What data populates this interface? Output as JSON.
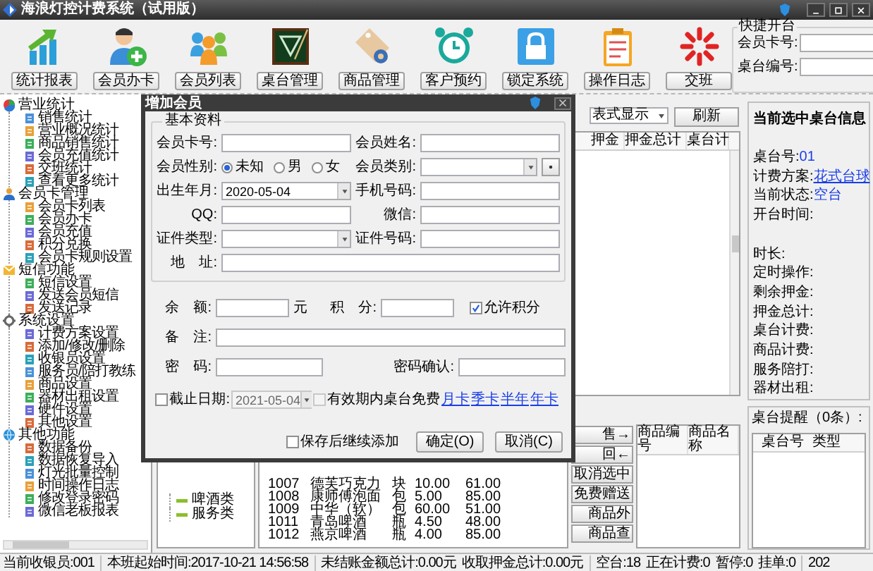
{
  "window": {
    "title": "海浪灯控计费系统（试用版）"
  },
  "toolbar": [
    {
      "label": "统计报表"
    },
    {
      "label": "会员办卡"
    },
    {
      "label": "会员列表"
    },
    {
      "label": "桌台管理"
    },
    {
      "label": "商品管理"
    },
    {
      "label": "客户预约"
    },
    {
      "label": "锁定系统"
    },
    {
      "label": "操作日志"
    },
    {
      "label": "交班"
    }
  ],
  "quick_open": {
    "title": "快捷开台",
    "fields": [
      {
        "label": "会员卡号:"
      },
      {
        "label": "桌台编号:"
      }
    ]
  },
  "tree": [
    {
      "label": "营业统计",
      "children": [
        {
          "label": "销售统计"
        },
        {
          "label": "营业概况统计"
        },
        {
          "label": "商品销售统计"
        },
        {
          "label": "会员充值统计"
        },
        {
          "label": "交班统计"
        },
        {
          "label": "查看更多统计"
        }
      ]
    },
    {
      "label": "会员卡管理",
      "children": [
        {
          "label": "会员卡列表"
        },
        {
          "label": "会员办卡"
        },
        {
          "label": "会员充值"
        },
        {
          "label": "积分兑换"
        },
        {
          "label": "会员卡规则设置"
        }
      ]
    },
    {
      "label": "短信功能",
      "children": [
        {
          "label": "短信设置"
        },
        {
          "label": "发送会员短信"
        },
        {
          "label": "发送记录"
        }
      ]
    },
    {
      "label": "系统设置",
      "children": [
        {
          "label": "计费方案设置"
        },
        {
          "label": "添加/修改/删除"
        },
        {
          "label": "收银员设置"
        },
        {
          "label": "服务员/陪打教练"
        },
        {
          "label": "商品设置"
        },
        {
          "label": "器材出租设置"
        },
        {
          "label": "硬件设置"
        },
        {
          "label": "其他设置"
        }
      ]
    },
    {
      "label": "其他功能",
      "children": [
        {
          "label": "数据备份"
        },
        {
          "label": "数据恢复导入"
        },
        {
          "label": "灯光批量控制"
        },
        {
          "label": "时间操作日志"
        },
        {
          "label": "修改登录密码"
        },
        {
          "label": "微信老板报表"
        }
      ]
    }
  ],
  "table_view": {
    "mode": "表式显示",
    "refresh": "刷新",
    "columns": [
      "押金",
      "押金总计",
      "桌台计"
    ]
  },
  "categories": [
    "啤酒类",
    "服务类"
  ],
  "products": [
    [
      "1007",
      "德芙巧克力",
      "块",
      "10.00",
      "61.00"
    ],
    [
      "1008",
      "康师傅泡面",
      "包",
      "5.00",
      "85.00"
    ],
    [
      "1009",
      "中华（软）",
      "包",
      "60.00",
      "51.00"
    ],
    [
      "1011",
      "青岛啤酒",
      "瓶",
      "4.50",
      "48.00"
    ],
    [
      "1012",
      "燕京啤酒",
      "瓶",
      "4.00",
      "85.00"
    ]
  ],
  "product_actions": [
    "售→",
    "回←",
    "取消选中",
    "免费赠送",
    "商品外",
    "商品查"
  ],
  "selected_products": {
    "columns": [
      "商品编号",
      "商品名称"
    ]
  },
  "table_info": {
    "title": "当前选中桌台信息",
    "fields": [
      {
        "label": "桌台号:",
        "value": "01",
        "link": false
      },
      {
        "label": "计费方案:",
        "value": "花式台球",
        "link": true
      },
      {
        "label": "当前状态:",
        "value": "空台",
        "link": false
      },
      {
        "label": "开台时间:"
      },
      {
        "label": "时长:"
      },
      {
        "label": "定时操作:"
      },
      {
        "label": "剩余押金:"
      },
      {
        "label": "押金总计:"
      },
      {
        "label": "桌台计费:"
      },
      {
        "label": "商品计费:"
      },
      {
        "label": "服务陪打:"
      },
      {
        "label": "器材出租:"
      }
    ]
  },
  "reminders": {
    "title": "桌台提醒（0条）:",
    "columns": [
      "桌台号",
      "类型"
    ]
  },
  "dialog": {
    "title": "增加会员",
    "section": "基本资料",
    "fields": [
      {
        "label": "会员卡号:",
        "kind": "text"
      },
      {
        "label": "会员姓名:",
        "kind": "text"
      },
      {
        "label": "会员性别:",
        "kind": "radio",
        "options": [
          {
            "label": "未知",
            "selected": true
          },
          {
            "label": "男",
            "selected": false
          },
          {
            "label": "女",
            "selected": false
          }
        ]
      },
      {
        "label": "会员类别:",
        "kind": "combo_add"
      },
      {
        "label": "出生年月:",
        "kind": "date",
        "value": "2020-05-04"
      },
      {
        "label": "手机号码:",
        "kind": "text"
      },
      {
        "label": "QQ:",
        "kind": "text"
      },
      {
        "label": "微信:",
        "kind": "text"
      },
      {
        "label": "证件类型:",
        "kind": "combo"
      },
      {
        "label": "证件号码:",
        "kind": "text"
      },
      {
        "label": "地　址:",
        "kind": "wide"
      }
    ],
    "balance": {
      "label": "余　额:",
      "unit": "元"
    },
    "points": {
      "label": "积　分:"
    },
    "allow_points": {
      "label": "允许积分",
      "checked": true
    },
    "note": {
      "label": "备　注:"
    },
    "password": {
      "label": "密　码:"
    },
    "confirm": {
      "label": "密码确认:"
    },
    "expiry": {
      "label": "截止日期:",
      "checked": false,
      "value": "2021-05-04"
    },
    "free_table": {
      "label": "有效期内桌台免费",
      "checked": false
    },
    "card_links": [
      "月卡",
      "季卡",
      "半年",
      "年卡"
    ],
    "keep_adding": {
      "label": "保存后继续添加",
      "checked": false
    },
    "buttons": [
      "确定(O)",
      "取消(C)"
    ]
  },
  "status_bar": [
    "当前收银员:001",
    "本班起始时间:2017-10-21 14:56:58",
    "未结账金额总计:0.00元",
    "收取押金总计:0.00元",
    "空台:18",
    "正在计费:0",
    "暂停:0",
    "挂单:0",
    "202"
  ]
}
